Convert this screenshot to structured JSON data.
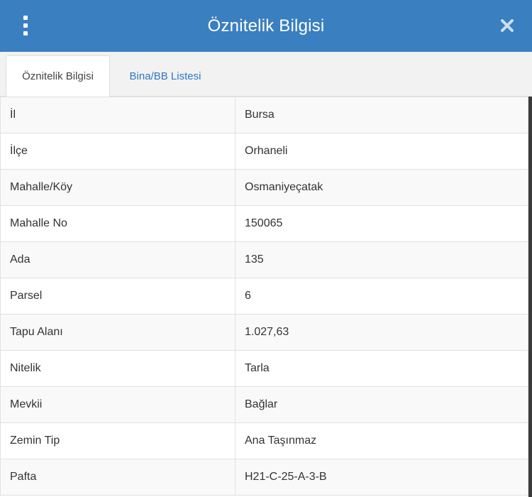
{
  "header": {
    "title": "Öznitelik Bilgisi",
    "menu_icon": "vertical-dots-icon",
    "close_icon": "close-icon",
    "background_color": "#3a7fc0"
  },
  "tabs": [
    {
      "label": "Öznitelik Bilgisi",
      "active": true
    },
    {
      "label": "Bina/BB Listesi",
      "active": false
    }
  ],
  "attributes": [
    {
      "key": "İl",
      "value": "Bursa"
    },
    {
      "key": "İlçe",
      "value": "Orhaneli"
    },
    {
      "key": "Mahalle/Köy",
      "value": "Osmaniyeçatak"
    },
    {
      "key": "Mahalle No",
      "value": "150065"
    },
    {
      "key": "Ada",
      "value": "135"
    },
    {
      "key": "Parsel",
      "value": "6"
    },
    {
      "key": "Tapu Alanı",
      "value": "1.027,63"
    },
    {
      "key": "Nitelik",
      "value": "Tarla"
    },
    {
      "key": "Mevkii",
      "value": "Bağlar"
    },
    {
      "key": "Zemin Tip",
      "value": "Ana Taşınmaz"
    },
    {
      "key": "Pafta",
      "value": "H21-C-25-A-3-B"
    }
  ]
}
